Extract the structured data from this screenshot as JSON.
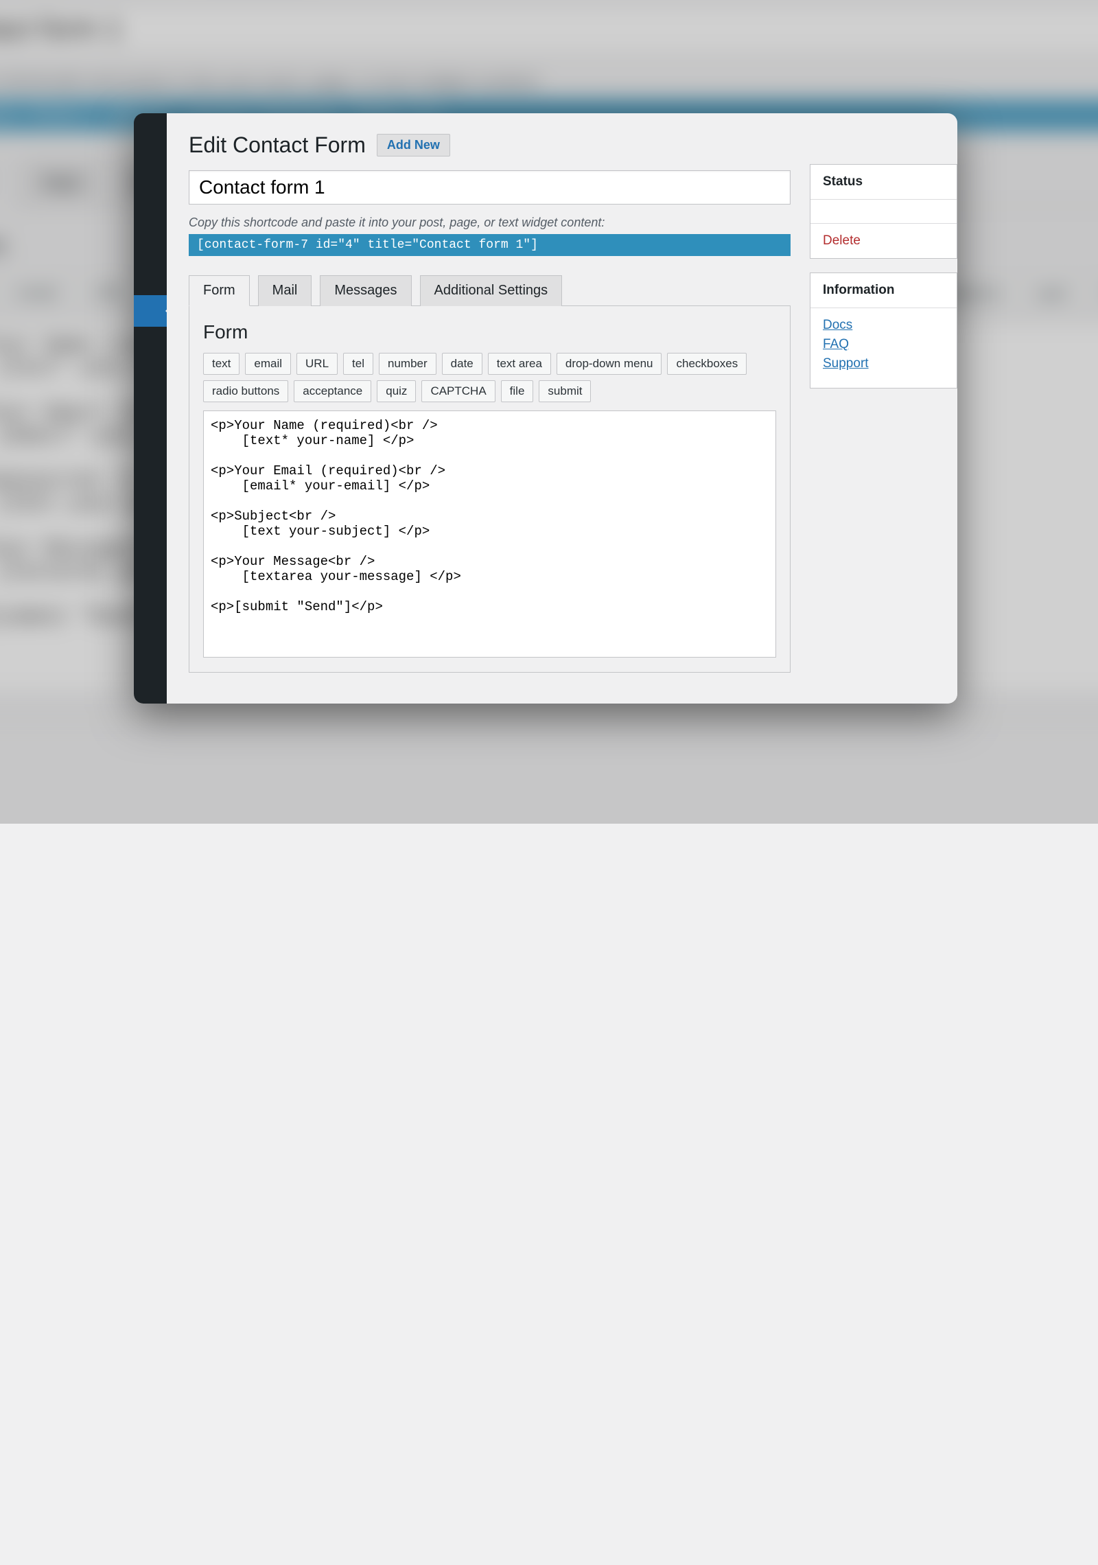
{
  "page": {
    "title": "Edit Contact Form",
    "add_new": "Add New"
  },
  "form_title_value": "Contact form 1",
  "shortcode_hint": "Copy this shortcode and paste it into your post, page, or text widget content:",
  "shortcode_value": "[contact-form-7 id=\"4\" title=\"Contact form 1\"]",
  "tabs": {
    "form": "Form",
    "mail": "Mail",
    "messages": "Messages",
    "additional": "Additional Settings"
  },
  "panel_heading": "Form",
  "tag_buttons": [
    "text",
    "email",
    "URL",
    "tel",
    "number",
    "date",
    "text area",
    "drop-down menu",
    "checkboxes",
    "radio buttons",
    "acceptance",
    "quiz",
    "CAPTCHA",
    "file",
    "submit"
  ],
  "form_template": "<p>Your Name (required)<br />\n    [text* your-name] </p>\n\n<p>Your Email (required)<br />\n    [email* your-email] </p>\n\n<p>Subject<br />\n    [text your-subject] </p>\n\n<p>Your Message<br />\n    [textarea your-message] </p>\n\n<p>[submit \"Send\"]</p>",
  "sidebar": {
    "status_heading": "Status",
    "delete": "Delete",
    "info_heading": "Information",
    "links": {
      "docs": "Docs",
      "faq": "FAQ",
      "support": "Support"
    }
  }
}
